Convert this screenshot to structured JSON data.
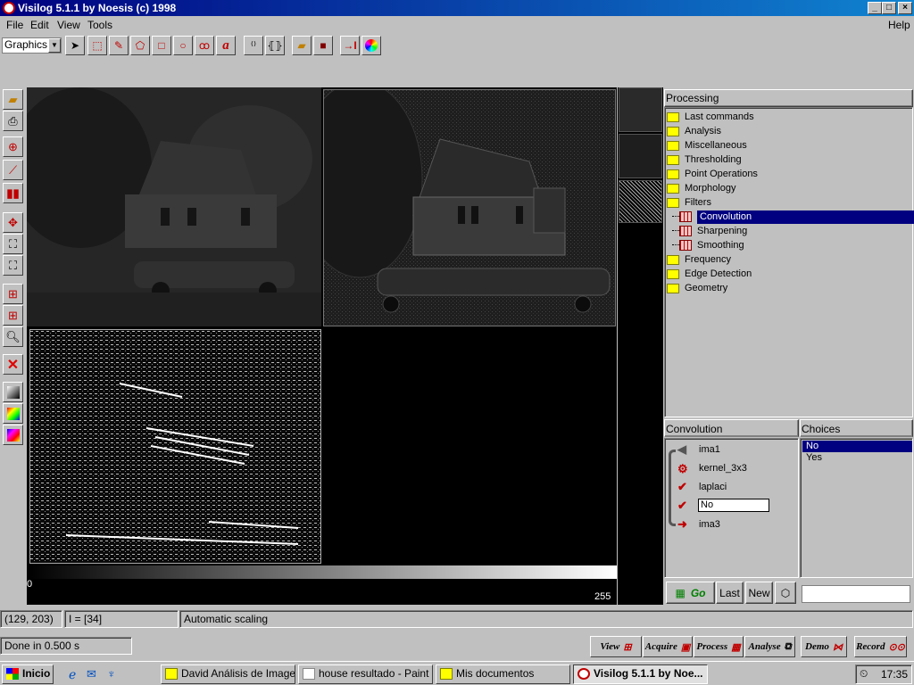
{
  "window": {
    "title": "Visilog 5.1.1 by Noesis (c) 1998"
  },
  "menu": {
    "file": "File",
    "edit": "Edit",
    "view": "View",
    "tools": "Tools",
    "help": "Help"
  },
  "toolbar": {
    "mode_select": "Graphics"
  },
  "image": {
    "scale_min": "0",
    "scale_max": "255"
  },
  "processing": {
    "title": "Processing",
    "items": [
      {
        "label": "Last commands",
        "type": "folder"
      },
      {
        "label": "Analysis",
        "type": "folder"
      },
      {
        "label": "Miscellaneous",
        "type": "folder"
      },
      {
        "label": "Thresholding",
        "type": "folder"
      },
      {
        "label": "Point Operations",
        "type": "folder"
      },
      {
        "label": "Morphology",
        "type": "folder"
      },
      {
        "label": "Filters",
        "type": "folder-open"
      },
      {
        "label": "Convolution",
        "type": "op",
        "selected": true
      },
      {
        "label": "Sharpening",
        "type": "op"
      },
      {
        "label": "Smoothing",
        "type": "op"
      },
      {
        "label": "Frequency",
        "type": "folder"
      },
      {
        "label": "Edge Detection",
        "type": "folder"
      },
      {
        "label": "Geometry",
        "type": "folder"
      }
    ]
  },
  "convolution": {
    "title": "Convolution",
    "params": [
      "ima1",
      "kernel_3x3",
      "laplaci"
    ],
    "input_value": "No",
    "output": "ima3"
  },
  "choices": {
    "title": "Choices",
    "options": [
      "No",
      "Yes"
    ],
    "selected": "No"
  },
  "actions": {
    "go": "Go",
    "last": "Last",
    "new": "New"
  },
  "status": {
    "coords": "(129, 203)",
    "intensity": "I = [34]",
    "scaling": "Automatic scaling",
    "done": "Done in 0.500 s"
  },
  "modes": {
    "view": "View",
    "acquire": "Acquire",
    "process": "Process",
    "analyse": "Analyse",
    "demo": "Demo",
    "record": "Record"
  },
  "taskbar": {
    "start": "Inicio",
    "tasks": [
      "David Análisis de Imagen",
      "house resultado - Paint",
      "Mis documentos",
      "Visilog 5.1.1 by Noe..."
    ],
    "clock": "17:35"
  }
}
